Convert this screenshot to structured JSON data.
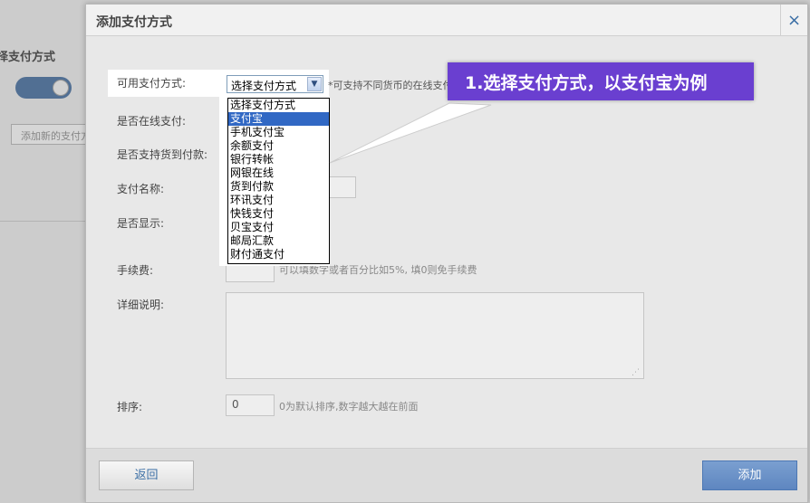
{
  "background": {
    "section_title": "择支付方式",
    "add_new_label": "添加新的支付方式"
  },
  "dialog": {
    "title": "添加支付方式",
    "close": "×"
  },
  "form": {
    "payment_method_label": "可用支付方式:",
    "selected_method": "选择支付方式",
    "payment_method_hint": "*可支持不同货币的在线支付",
    "online_label": "是否在线支付:",
    "cod_label": "是否支持货到付款:",
    "name_label": "支付名称:",
    "display_label": "是否显示:",
    "fee_label": "手续费:",
    "fee_hint": "可以填数字或者百分比如5%, 填0则免手续费",
    "desc_label": "详细说明:",
    "sort_label": "排序:",
    "sort_value": "0",
    "sort_hint": "0为默认排序,数字越大越在前面"
  },
  "dropdown": {
    "options": [
      "选择支付方式",
      "支付宝",
      "手机支付宝",
      "余额支付",
      "银行转帐",
      "网银在线",
      "货到付款",
      "环讯支付",
      "快钱支付",
      "贝宝支付",
      "邮局汇款",
      "财付通支付"
    ],
    "highlighted_index": 1,
    "highlight_color": "#3168c4"
  },
  "callout": {
    "text": "1.选择支付方式，以支付宝为例",
    "color": "#6a3fd0"
  },
  "footer": {
    "back_label": "返回",
    "add_label": "添加"
  }
}
